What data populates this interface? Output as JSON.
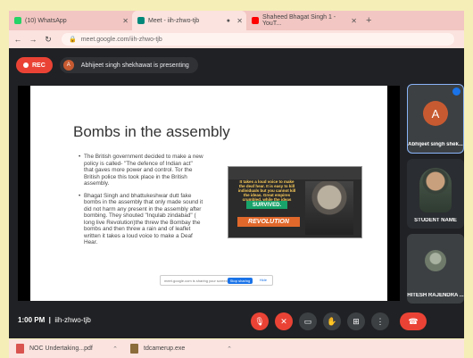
{
  "browser": {
    "tabs": [
      {
        "label": "(10) WhatsApp",
        "favicon_color": "#25d366"
      },
      {
        "label": "Meet - iih-zhwo-tjb",
        "favicon_color": "#00897b"
      },
      {
        "label": "Shaheed Bhagat Singh 1 - YouT...",
        "favicon_color": "#ff0000"
      }
    ],
    "url": "meet.google.com/iih-zhwo-tjb"
  },
  "meet": {
    "rec_label": "REC",
    "presenter_initial": "A",
    "presenting_text": "Abhijeet singh shekhawat is presenting",
    "meeting_time": "1:00 PM",
    "meeting_code": "iih-zhwo-tjb",
    "participants": [
      {
        "name": "Abhijeet singh shek...",
        "initial": "A"
      },
      {
        "name": "STUDENT NAME"
      },
      {
        "name": "HITESH RAJENDRA ..."
      }
    ]
  },
  "slide": {
    "title": "Bombs in the assembly",
    "bullets": [
      "The British government decided to make a new policy is called- \"The defence of Indian act\" that gaves more power and control. Tor the British police this took place in the British assembly.",
      "Bhagat Singh and bhattukeshwar dutt fake bombs in the assembly that only made sound it did not harm any present in the assembly after bombing. They shouted \"Inqulab zindabad\" ( long live Revolution)the threw the Bombay the bombs and then threw a rain and of leaflet written it takes a loud voice to make a Deaf Hear."
    ],
    "poster_text": "It takes a loud voice to make the deaf hear. It is easy to kill individuals but you cannot kill the ideas. Great empires crumbled, while the ideas",
    "poster_survived": "SURVIVED.",
    "poster_revolution": "REVOLUTION"
  },
  "share_bar": {
    "text": "meet.google.com is sharing your screen.",
    "stop_label": "Stop sharing",
    "hide_label": "Hide"
  },
  "downloads": [
    {
      "name": "NOC Undertaking...pdf",
      "type": "pdf"
    },
    {
      "name": "tdcamerup.exe",
      "type": "exe"
    }
  ]
}
